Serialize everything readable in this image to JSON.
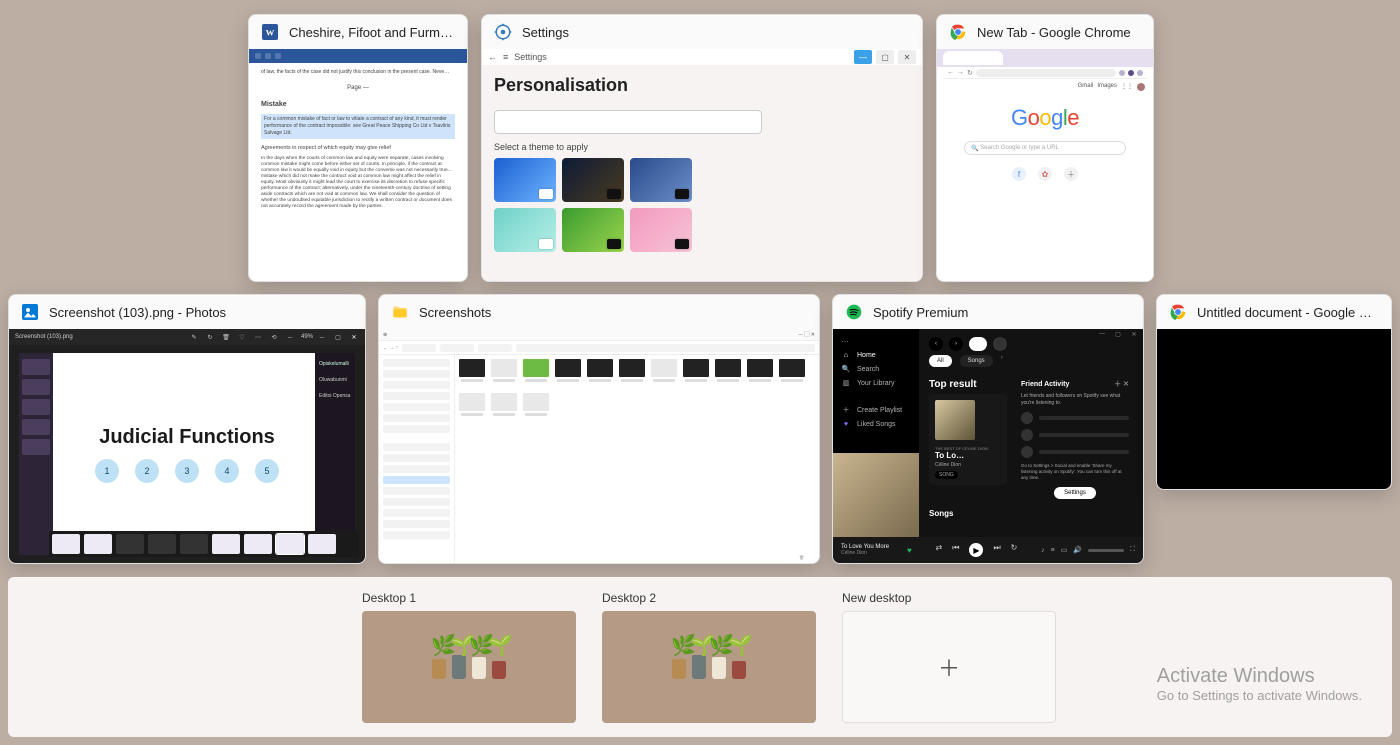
{
  "windows": {
    "word": {
      "title": "Cheshire, Fifoot and Furmsto…",
      "doc_heading": "Mistake",
      "para1": "of law, the facts of the case did not justify this conclusion in the present case. Neve…",
      "para2": "For a common mistake of fact or law to vitiate a contract of any kind, it must render performance of the contract impossible: see Great Peace Shipping Co Ltd v Tsavliris Salvage Ltd.",
      "para3": "Agreements in respect of which equity may give relief",
      "para4": "In the days when the courts of common law and equity were separate, cases involving common mistake might come before either set of courts. In principle, if the contract at common law it would be equally void in equity but the converse was not necessarily true… mistake which did not make the contract void at common law might affect the relief in equity. Most obviously it might lead the court to exercise its discretion to refuse specific performance of the contract; alternatively, under the nineteenth-century doctrine of setting aside contracts which are not void at common law. We shall consider the question of whether the undoubted equitable jurisdiction to rectify a written contract or document does not accurately record the agreement made by the parties."
    },
    "settings": {
      "title": "Settings",
      "header": "Personalisation",
      "select_label": "Select a theme to apply",
      "inner_title": "Settings"
    },
    "chrome": {
      "title": "New Tab - Google Chrome",
      "search_placeholder": "Search Google or type a URL",
      "links": [
        "Gmail",
        "Images"
      ]
    },
    "photos": {
      "title": "Screenshot (103).png - Photos",
      "filename": "Screenshot (103).png",
      "zoom": "49%",
      "slide_title": "Judicial Functions",
      "right_labels": [
        "Opiskelumalli",
        "Oluwabunmi",
        "Editoi Opensa"
      ]
    },
    "explorer": {
      "title": "Screenshots"
    },
    "spotify": {
      "title": "Spotify Premium",
      "nav": {
        "home": "Home",
        "search": "Search",
        "library": "Your Library",
        "create": "Create Playlist",
        "liked": "Liked Songs"
      },
      "tabs": [
        "All",
        "Songs"
      ],
      "section_top": "Top result",
      "result": {
        "title": "To Lo…",
        "artist": "Céline Dion",
        "tag": "SONG",
        "overline": "THE BEST OF CÉLINE DION"
      },
      "friend": {
        "heading": "Friend Activity",
        "desc": "Let friends and followers on Spotify see what you're listening to.",
        "tip": "Go to Settings > Social and enable 'Share my listening activity on Spotify'. You can turn this off at any time.",
        "button": "Settings"
      },
      "section_songs": "Songs",
      "now_playing": {
        "track": "To Love You More",
        "artist": "Céline Dion"
      }
    },
    "docs": {
      "title": "Untitled document - Google Do…"
    }
  },
  "desktops": {
    "d1": "Desktop 1",
    "d2": "Desktop 2",
    "new": "New desktop"
  },
  "watermark": {
    "line1": "Activate Windows",
    "line2": "Go to Settings to activate Windows."
  }
}
